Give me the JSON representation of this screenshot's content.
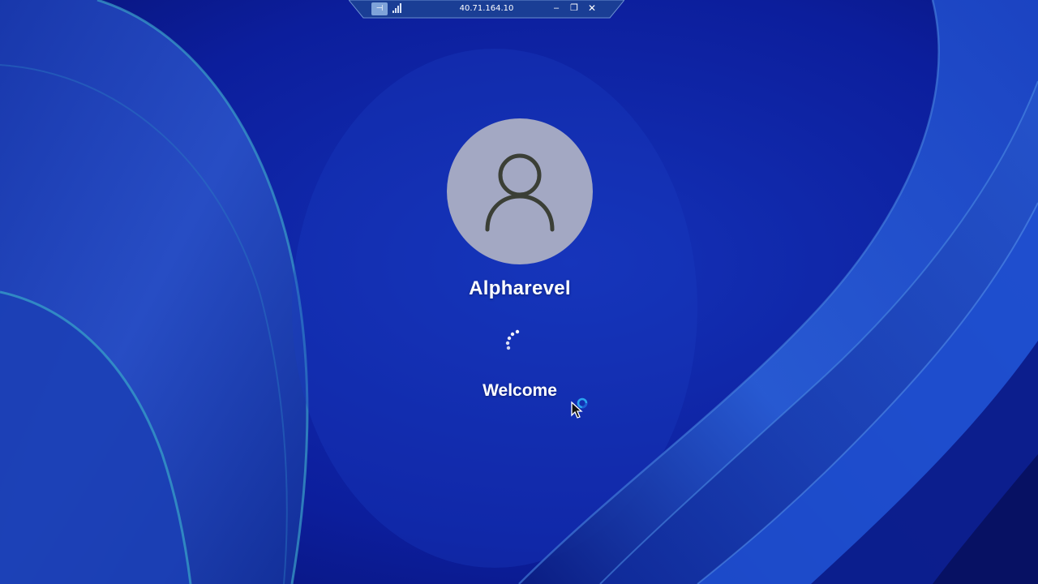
{
  "remote_bar": {
    "title": "40.71.164.10",
    "pin_icon": "pin-icon",
    "signal_icon": "signal-bars-icon",
    "minimize_label": "–",
    "restore_label": "❐",
    "close_label": "✕"
  },
  "login": {
    "avatar_icon": "user-silhouette-icon",
    "username": "Alpharevel",
    "status": "Welcome",
    "spinner_icon": "loading-spinner-icon"
  },
  "cursor_icon": "busy-arrow-cursor-icon",
  "colors": {
    "wallpaper_base": "#0d1f9a",
    "avatar_bg": "#a3a8c3",
    "avatar_icon": "#3b3f36",
    "text": "#ffffff",
    "bar_bg": "#1a3e95"
  }
}
